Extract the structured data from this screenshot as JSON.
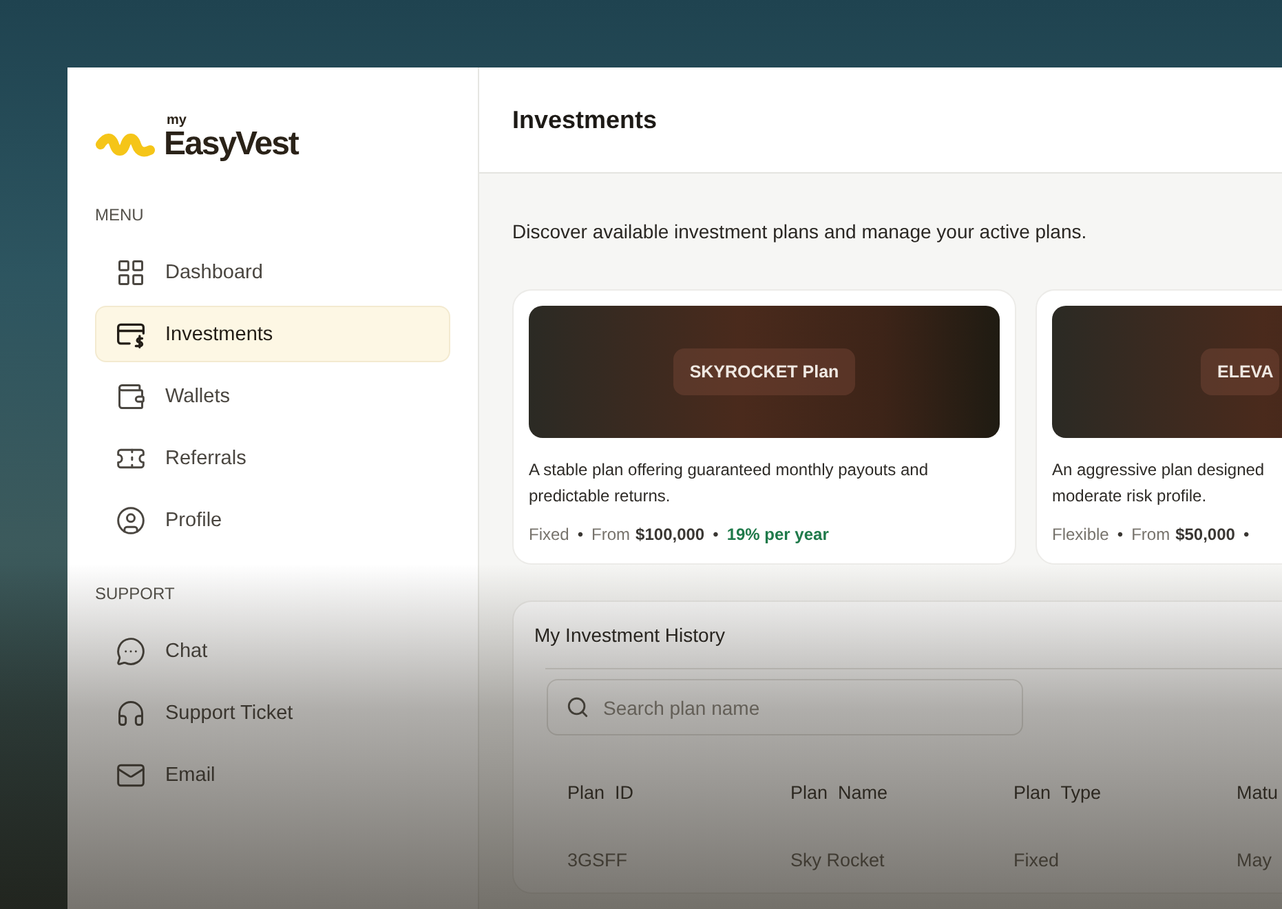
{
  "brand": {
    "prefix": "my",
    "name": "EasyVest"
  },
  "sidebar": {
    "sections": [
      {
        "heading": "MENU",
        "items": [
          {
            "label": "Dashboard",
            "selected": false
          },
          {
            "label": "Investments",
            "selected": true
          },
          {
            "label": "Wallets",
            "selected": false
          },
          {
            "label": "Referrals",
            "selected": false
          },
          {
            "label": "Profile",
            "selected": false
          }
        ]
      },
      {
        "heading": "SUPPORT",
        "items": [
          {
            "label": "Chat",
            "selected": false
          },
          {
            "label": "Support Ticket",
            "selected": false
          },
          {
            "label": "Email",
            "selected": false
          }
        ]
      }
    ]
  },
  "header": {
    "title": "Investments"
  },
  "intro": "Discover available investment plans and manage your active plans.",
  "plans": [
    {
      "banner": "SKYROCKET Plan",
      "description": [
        "A stable plan offering guaranteed monthly payouts and",
        "predictable returns."
      ],
      "meta": [
        {
          "kind": "type",
          "text": "Fixed"
        },
        {
          "kind": "sep",
          "text": "•"
        },
        {
          "kind": "label",
          "text": "From"
        },
        {
          "kind": "amount",
          "text": "$100,000"
        },
        {
          "kind": "sep",
          "text": "•"
        },
        {
          "kind": "rate",
          "text": "19% per year"
        }
      ]
    },
    {
      "banner": "ELEVA",
      "description": [
        "An aggressive plan designed",
        "moderate risk profile."
      ],
      "meta": [
        {
          "kind": "type",
          "text": "Flexible"
        },
        {
          "kind": "sep",
          "text": "•"
        },
        {
          "kind": "label",
          "text": "From"
        },
        {
          "kind": "amount",
          "text": "$50,000"
        },
        {
          "kind": "sep",
          "text": "•"
        }
      ]
    }
  ],
  "history": {
    "title": "My Investment History",
    "search": {
      "placeholder": "Search plan name"
    },
    "table": {
      "columns": [
        "Plan  ID",
        "Plan  Name",
        "Plan  Type",
        "Matu"
      ],
      "rows": [
        [
          "3GSFF",
          "Sky Rocket",
          "Fixed",
          "May"
        ]
      ]
    }
  }
}
